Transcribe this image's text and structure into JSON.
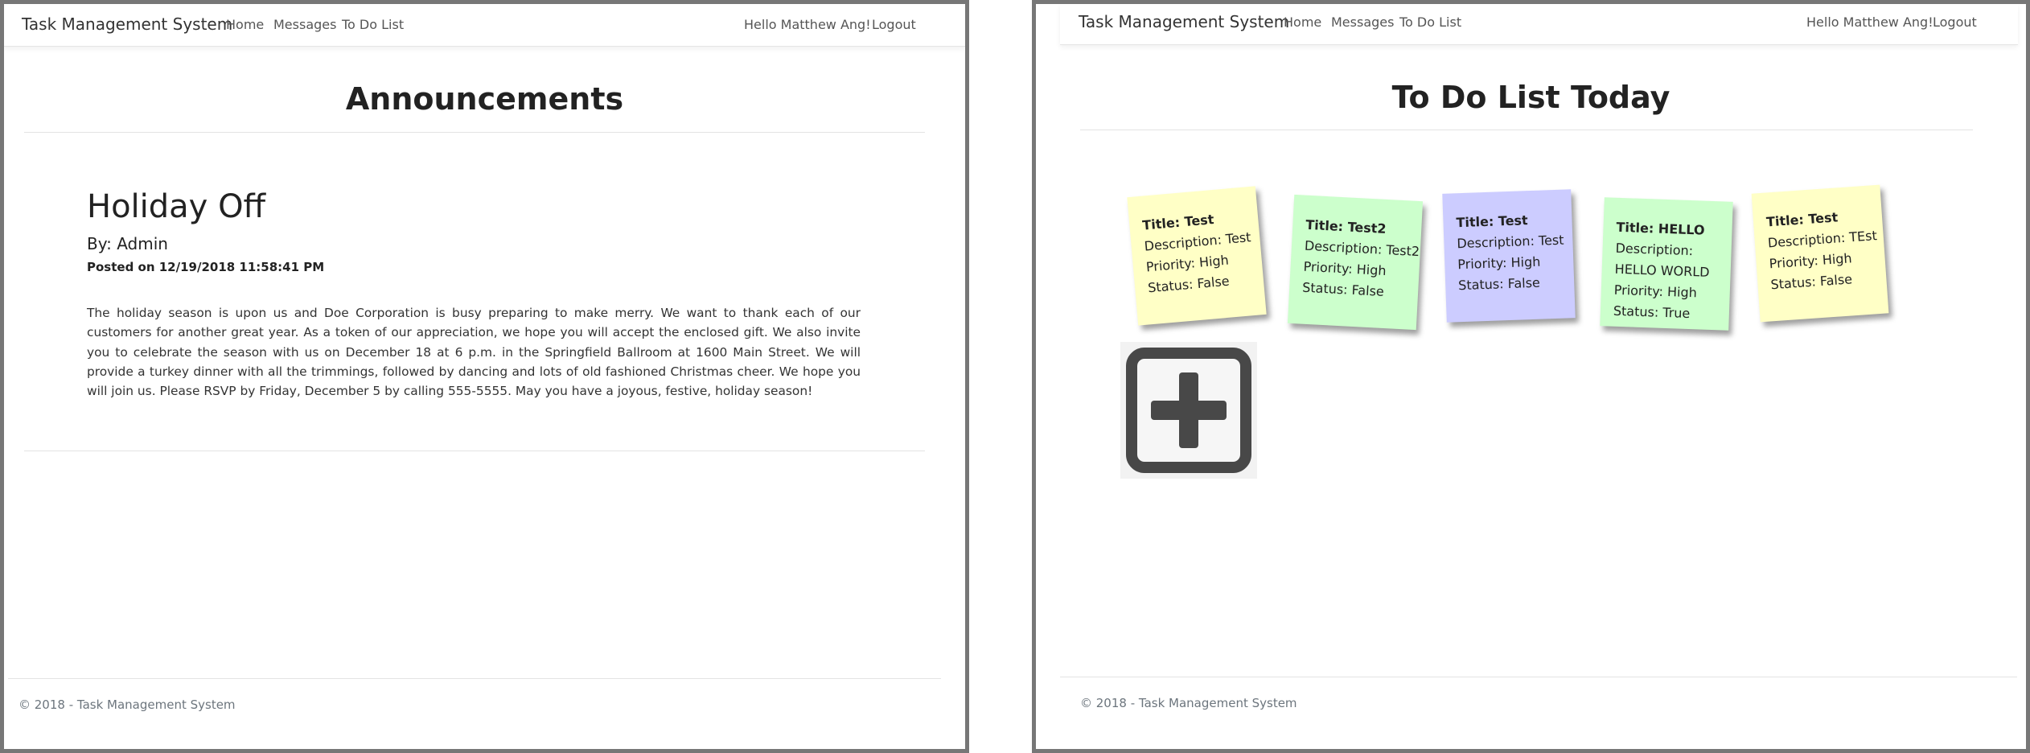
{
  "left_window": {
    "navbar": {
      "brand": "Task Management System",
      "links": [
        "Home",
        "Messages",
        "To Do List"
      ],
      "greeting": "Hello Matthew Ang!",
      "logout": "Logout"
    },
    "page_title": "Announcements",
    "announcement": {
      "title": "Holiday Off",
      "author": "By: Admin",
      "posted": "Posted on 12/19/2018 11:58:41 PM",
      "body": "The holiday season is upon us and Doe Corporation is busy preparing to make merry. We want to thank each of our customers for another great year. As a token of our appreciation, we hope you will accept the enclosed gift. We also invite you to celebrate the season with us on December 18 at 6 p.m. in the Springfield Ballroom at 1600 Main Street. We will provide a turkey dinner with all the trimmings, followed by dancing and lots of old fashioned Christmas cheer. We hope you will join us. Please RSVP by Friday, December 5 by calling 555-5555. May you have a joyous, festive, holiday season!"
    },
    "footer": "© 2018 - Task Management System"
  },
  "right_window": {
    "navbar": {
      "brand": "Task Management System",
      "links": [
        "Home",
        "Messages",
        "To Do List"
      ],
      "greeting": "Hello Matthew Ang!",
      "logout": "Logout"
    },
    "page_title": "To Do List Today",
    "notes": [
      {
        "title": "Title: Test",
        "description": "Description: Test",
        "priority": "Priority: High",
        "status": "Status: False",
        "color": "#ffffc6"
      },
      {
        "title": "Title: Test2",
        "description": "Description: Test2",
        "priority": "Priority: High",
        "status": "Status: False",
        "color": "#ccffcc"
      },
      {
        "title": "Title: Test",
        "description": "Description: Test",
        "priority": "Priority: High",
        "status": "Status: False",
        "color": "#ccccff"
      },
      {
        "title": "Title: HELLO",
        "description_label": "Description:",
        "description": "HELLO WORLD",
        "priority": "Priority: High",
        "status": "Status: True",
        "color": "#ccffcc"
      },
      {
        "title": "Title: Test",
        "description": "Description: TEst",
        "priority": "Priority: High",
        "status": "Status: False",
        "color": "#ffffc6"
      }
    ],
    "add_icon": "plus-square-icon",
    "footer": "© 2018 - Task Management System"
  }
}
